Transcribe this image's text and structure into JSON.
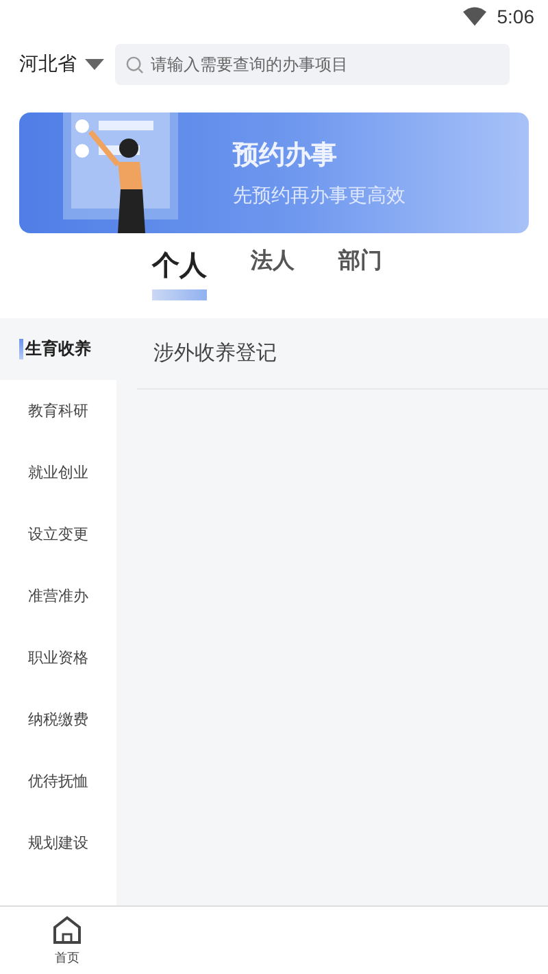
{
  "status_bar": {
    "time": "5:06"
  },
  "header": {
    "region": "河北省",
    "search": {
      "placeholder": "请输入需要查询的办事项目"
    }
  },
  "banner": {
    "title": "预约办事",
    "subtitle": "先预约再办事更高效"
  },
  "tabs": [
    {
      "label": "个人",
      "selected": true
    },
    {
      "label": "法人",
      "selected": false
    },
    {
      "label": "部门",
      "selected": false
    }
  ],
  "sidebar": {
    "items": [
      {
        "label": "生育收养",
        "selected": true
      },
      {
        "label": "教育科研",
        "selected": false
      },
      {
        "label": "就业创业",
        "selected": false
      },
      {
        "label": "设立变更",
        "selected": false
      },
      {
        "label": "准营准办",
        "selected": false
      },
      {
        "label": "职业资格",
        "selected": false
      },
      {
        "label": "纳税缴费",
        "selected": false
      },
      {
        "label": "优待抚恤",
        "selected": false
      },
      {
        "label": "规划建设",
        "selected": false
      }
    ]
  },
  "services": [
    {
      "label": "涉外收养登记"
    }
  ],
  "bottom_nav": [
    {
      "label": "首页",
      "selected": true
    }
  ]
}
